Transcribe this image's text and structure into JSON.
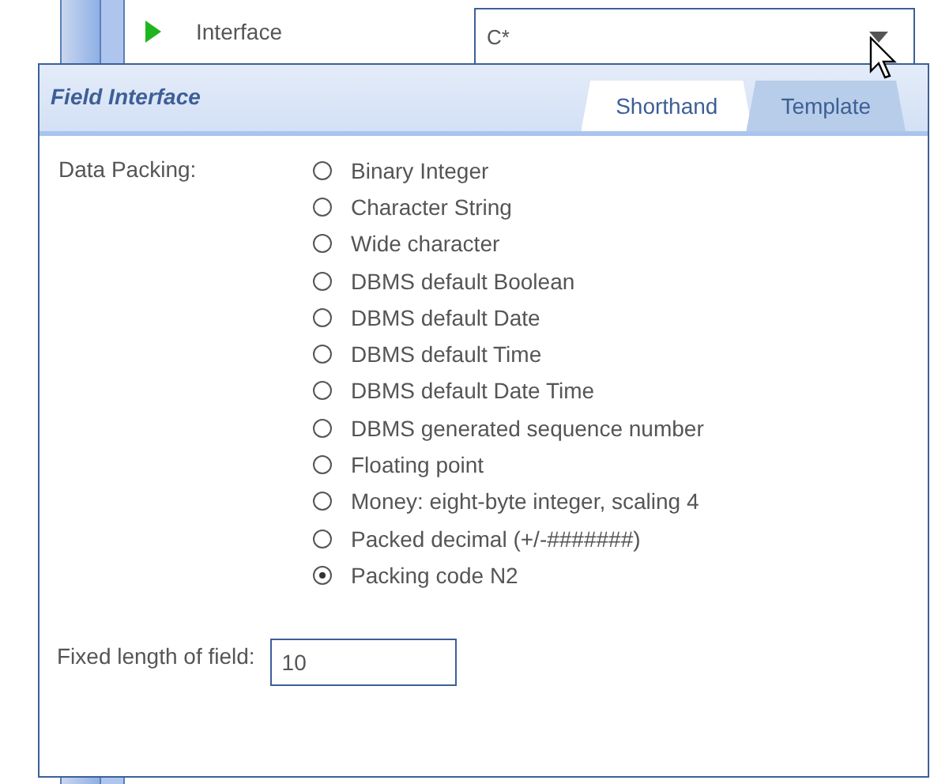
{
  "row": {
    "label": "Interface",
    "value": "C*"
  },
  "panel": {
    "title": "Field Interface",
    "tabs": [
      {
        "label": "Shorthand",
        "selected": true
      },
      {
        "label": "Template",
        "selected": false
      }
    ],
    "packing_label": "Data Packing:",
    "options": [
      {
        "label": "Binary Integer",
        "selected": false
      },
      {
        "label": "Character String",
        "selected": false
      },
      {
        "label": "Wide character",
        "selected": false
      },
      {
        "label": "DBMS default Boolean",
        "selected": false
      },
      {
        "label": "DBMS default Date",
        "selected": false
      },
      {
        "label": "DBMS default Time",
        "selected": false
      },
      {
        "label": "DBMS default Date Time",
        "selected": false
      },
      {
        "label": "DBMS generated sequence number",
        "selected": false
      },
      {
        "label": "Floating point",
        "selected": false
      },
      {
        "label": "Money: eight-byte integer, scaling 4",
        "selected": false
      },
      {
        "label": "Packed decimal (+/-#######)",
        "selected": false
      },
      {
        "label": "Packing code N2",
        "selected": true
      }
    ],
    "length_label": "Fixed length of field:",
    "length_value": "10"
  }
}
